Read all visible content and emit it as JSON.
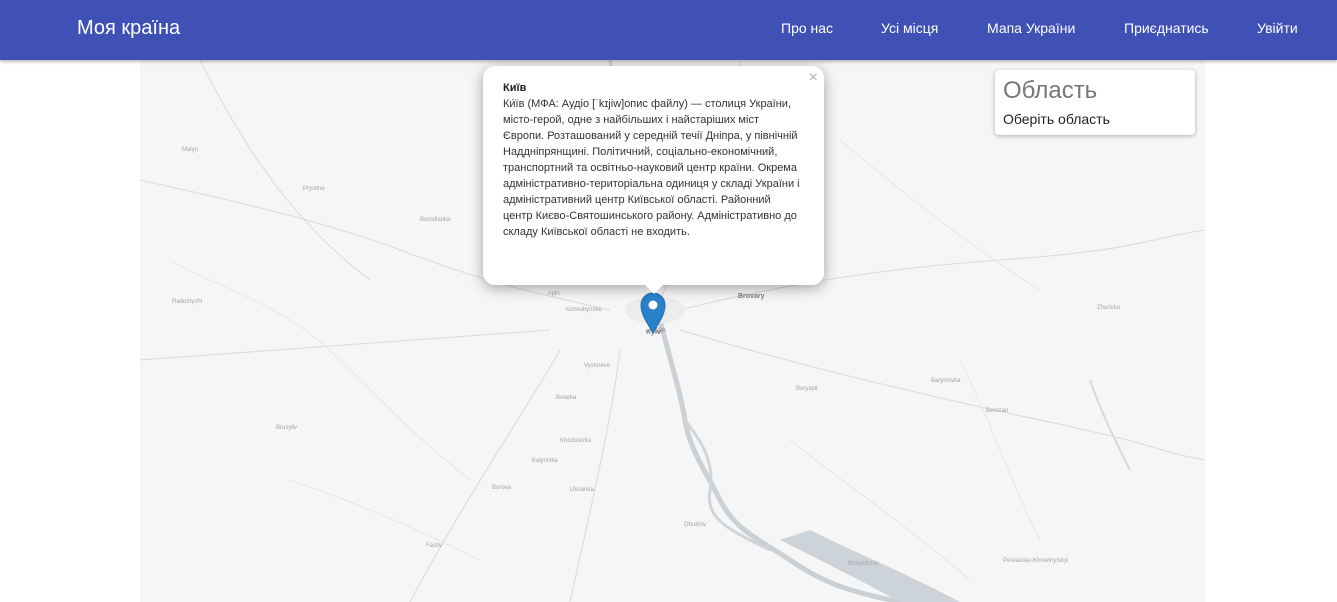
{
  "navbar": {
    "brand": "Моя країна",
    "items": [
      {
        "label": "Про нас"
      },
      {
        "label": "Усі місця"
      },
      {
        "label": "Мапа України"
      },
      {
        "label": "Приєднатись"
      },
      {
        "label": "Увійти"
      }
    ],
    "color": "#3f51b5"
  },
  "popup": {
    "title": "Київ",
    "text": "Ки́їв (МФА: Аудіо [ˈkɪjiw]опис файлу) — столиця України, місто-герой, одне з найбільших і найстаріших міст Європи. Розташований у середній течії Дніпра, у північній Наддніпрянщині. Політичний, соціально-економічний, транспортний та освітньо-науковий центр країни. Окрема адміністративно-територіальна одиниця у складі України і адміністративний центр Київської області. Районний центр Києво-Святошинського району. Адміністративно до складу Київської області не входить.",
    "close": "×"
  },
  "region_control": {
    "title": "Область",
    "select_text": "Оберіть область"
  },
  "map": {
    "marker_color": "#2a81cb",
    "labels": {
      "malyn": "Malyn",
      "pryvitne": "Pryvitne",
      "borodianka": "Borodianka",
      "radomyshl": "Radomyshl",
      "irpin": "Irpin",
      "kotsiubynske": "Kotsiubynske",
      "kyiv": "Kyiv",
      "brovary": "Brovary",
      "vyshneve": "Vyshneve",
      "boiarka": "Boiarka",
      "khodosivka": "Khodosivka",
      "kalynivka": "Kalynivka",
      "borova": "Borova",
      "ukrainka": "Ukrainka",
      "brusyliv": "Brusyliv",
      "fastiv": "Fastiv",
      "obukhiv": "Obukhiv",
      "boryspil": "Boryspil",
      "baryshivka": "Baryshivka",
      "berezan": "Berezan",
      "zhurivka": "Zhurivka",
      "pereiaslav": "Pereiaslav-Khmelnytskyi",
      "rzhyshchiv": "Rzhyshchiv"
    }
  }
}
